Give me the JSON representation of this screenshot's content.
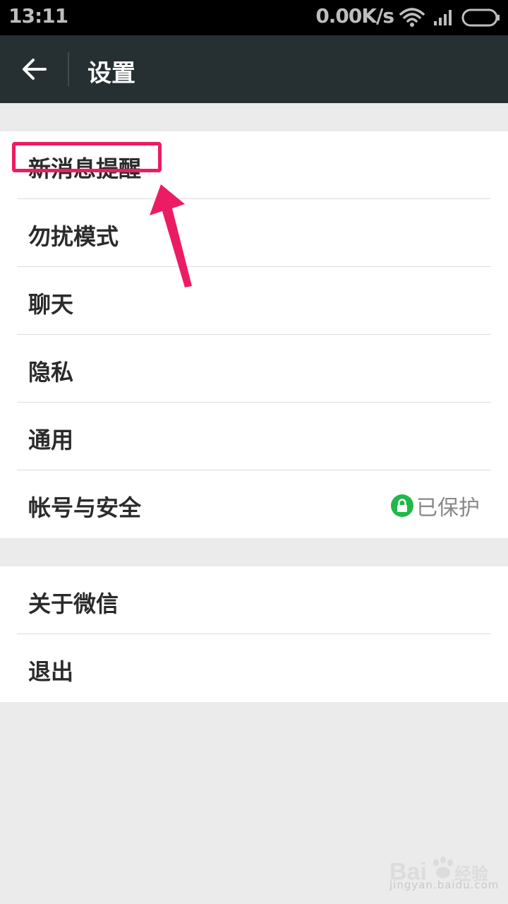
{
  "status_bar": {
    "time": "13:11",
    "network_speed": "0.00K/s",
    "icons": [
      "wifi-icon",
      "signal-icon",
      "battery-icon"
    ]
  },
  "action_bar": {
    "title": "设置",
    "back_icon": "arrow-left-icon"
  },
  "groups": [
    {
      "items": [
        {
          "label": "新消息提醒"
        },
        {
          "label": "勿扰模式"
        },
        {
          "label": "聊天"
        },
        {
          "label": "隐私"
        },
        {
          "label": "通用"
        },
        {
          "label": "帐号与安全",
          "status": "已保护"
        }
      ]
    },
    {
      "items": [
        {
          "label": "关于微信"
        },
        {
          "label": "退出"
        }
      ]
    }
  ],
  "annotation": {
    "highlighted_item": "新消息提醒",
    "color": "#ec1c64"
  },
  "colors": {
    "action_bar": "#263033",
    "background": "#ebebeb",
    "lock_badge": "#21b84a"
  },
  "watermark": {
    "logo": "Bai du 经验",
    "sub": "jingyan.baidu.com"
  }
}
